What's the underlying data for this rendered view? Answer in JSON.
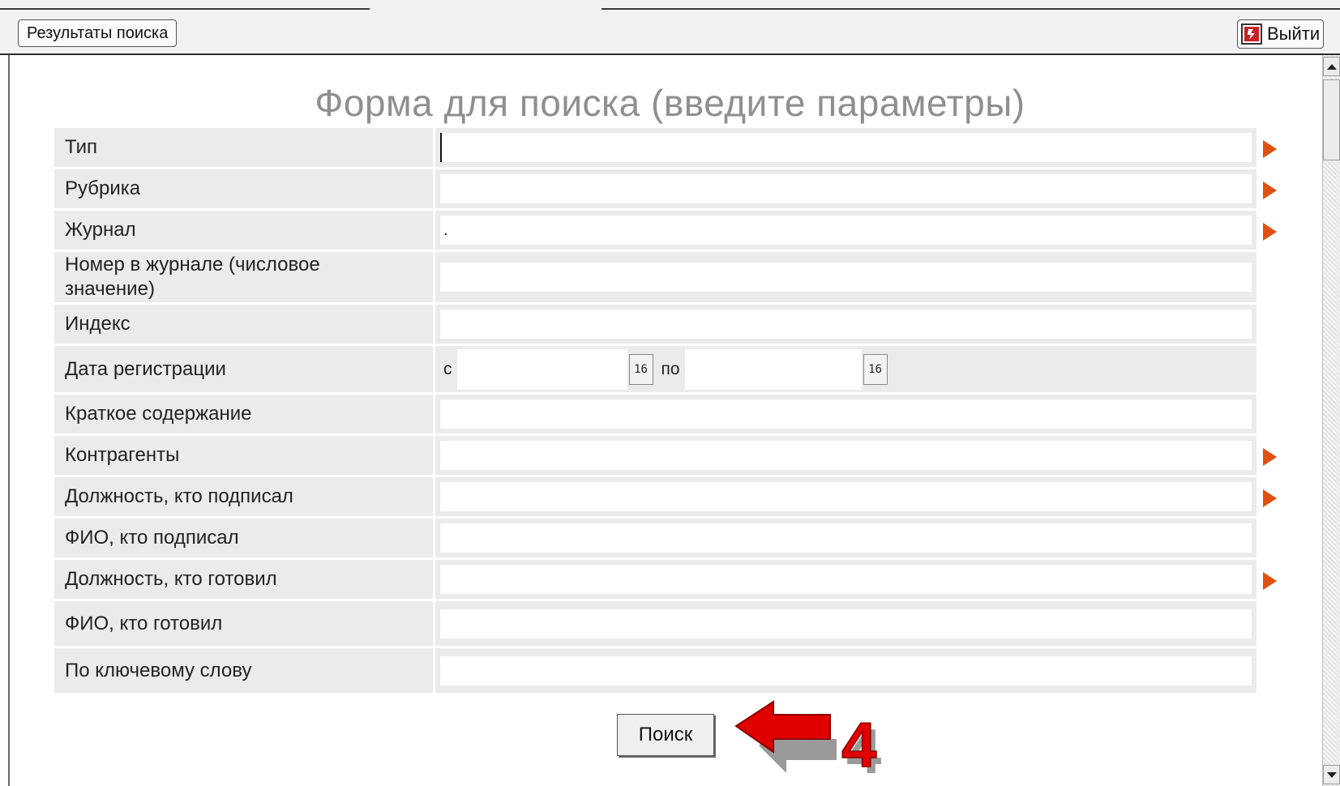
{
  "toolbar": {
    "results_label": "Результаты поиска",
    "exit_label": "Выйти"
  },
  "form": {
    "title": "Форма для поиска (введите параметры)",
    "fields": [
      {
        "label": "Тип",
        "value": ""
      },
      {
        "label": "Рубрика",
        "value": ""
      },
      {
        "label": "Журнал",
        "value": "."
      },
      {
        "label": "Номер в журнале (числовое значение)",
        "value": ""
      },
      {
        "label": "Индекс",
        "value": ""
      },
      {
        "label": "Дата регистрации",
        "from_label": "с",
        "to_label": "по",
        "calendar_text": "16"
      },
      {
        "label": "Краткое содержание",
        "value": ""
      },
      {
        "label": "Контрагенты",
        "value": ""
      },
      {
        "label": "Должность, кто подписал",
        "value": ""
      },
      {
        "label": "ФИО, кто подписал",
        "value": ""
      },
      {
        "label": "Должность, кто готовил",
        "value": ""
      },
      {
        "label": "ФИО, кто готовил",
        "value": ""
      },
      {
        "label": "По ключевому слову",
        "value": ""
      }
    ],
    "search_label": "Поиск"
  },
  "annotation": {
    "step_number": "4",
    "arrow_color": "#e00000"
  },
  "colors": {
    "picker_arrow": "#e0500f",
    "title_gray": "#8f8f8f",
    "row_bg": "#ebebeb"
  }
}
